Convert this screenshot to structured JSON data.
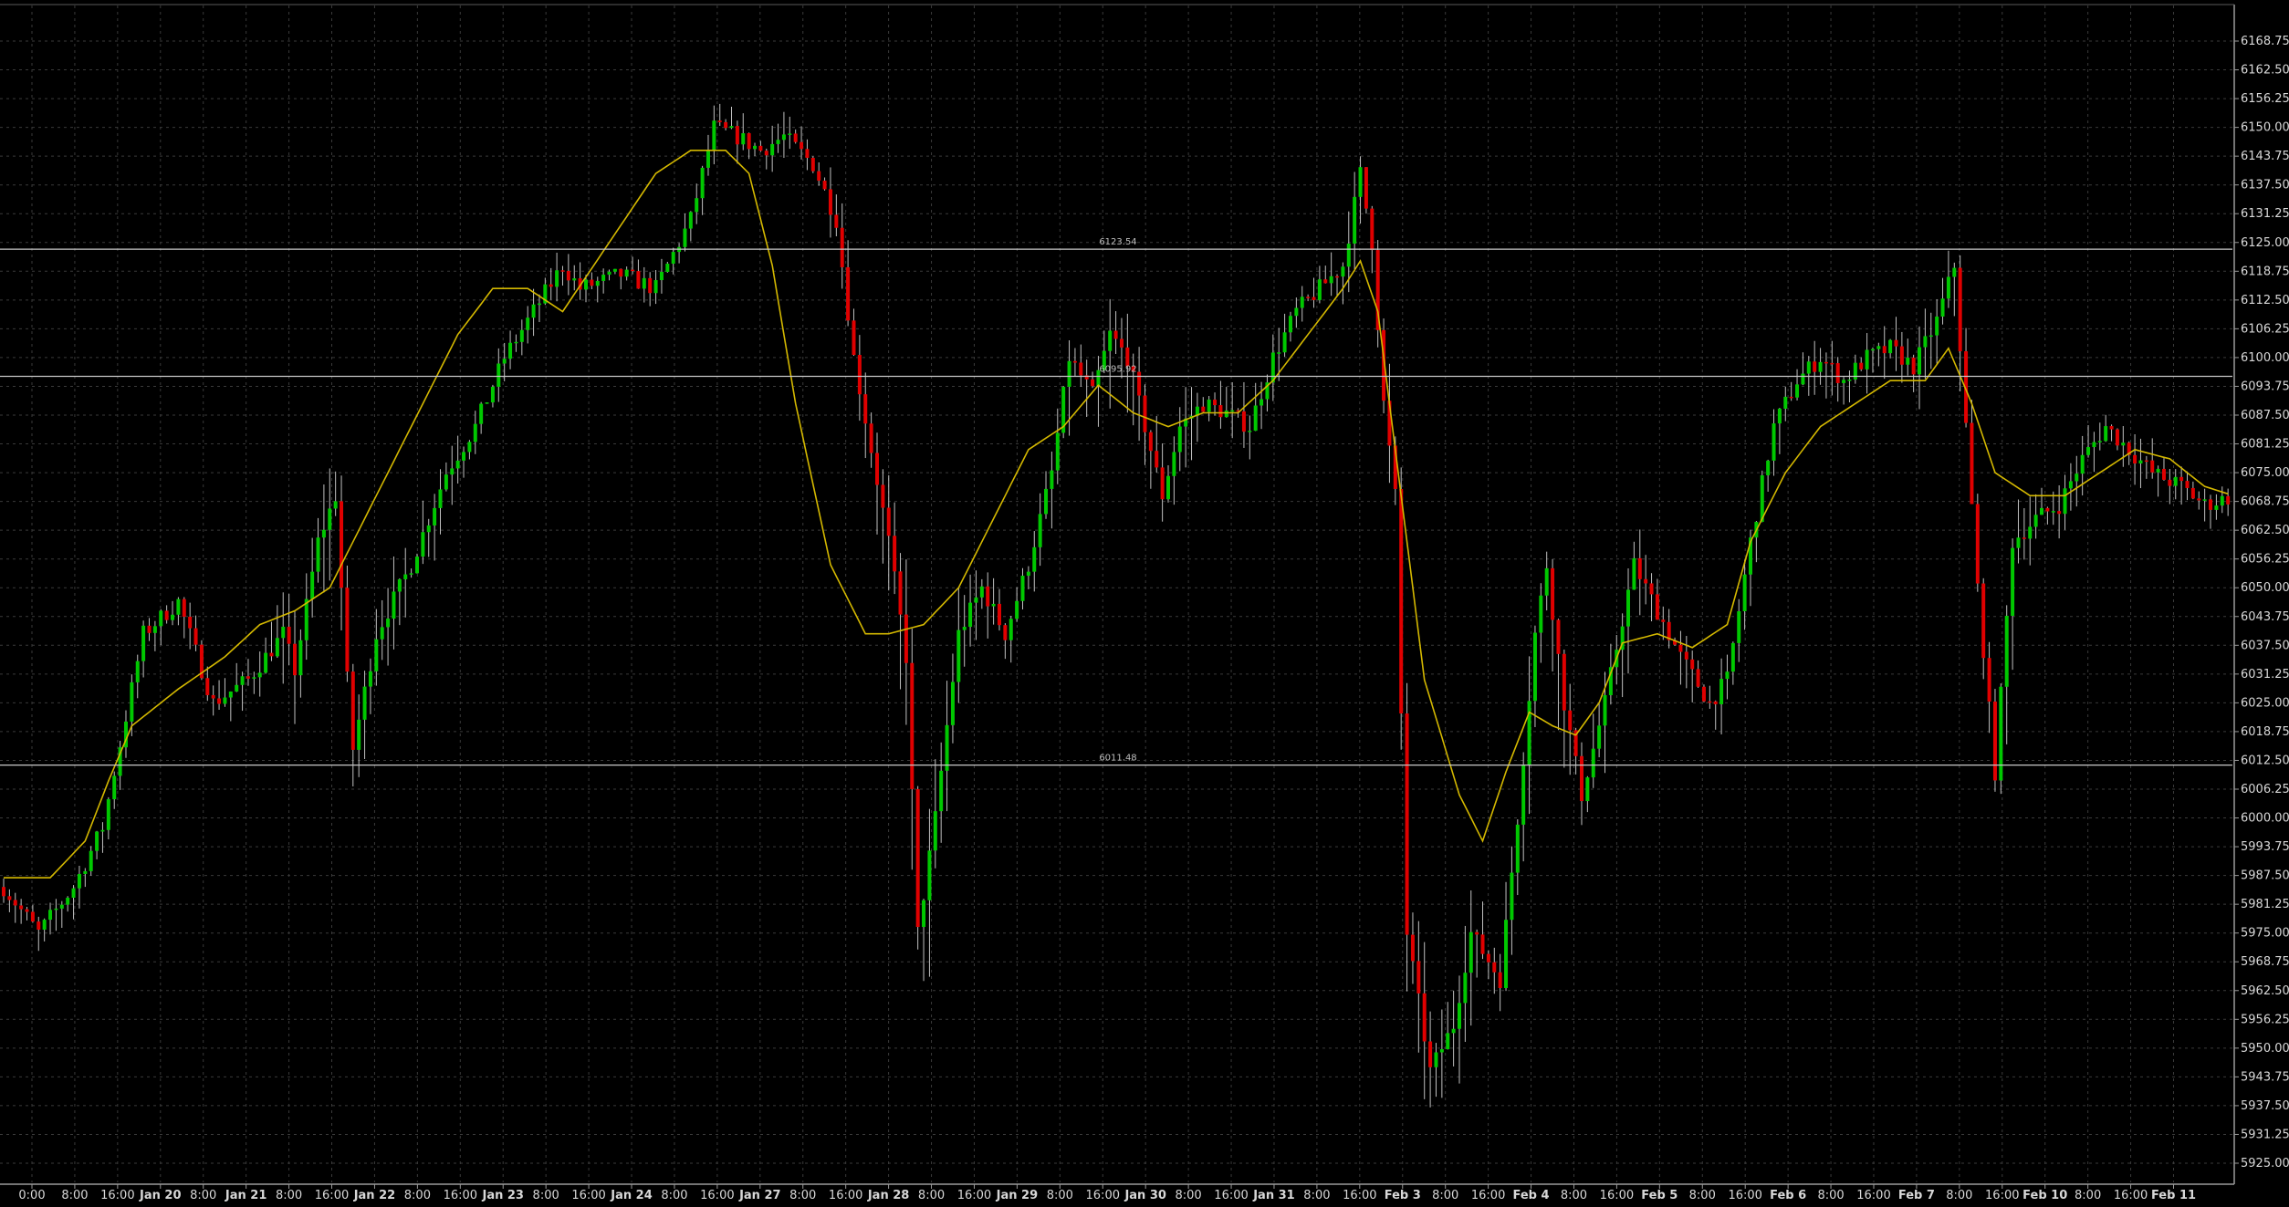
{
  "chart_data": {
    "type": "candlestick",
    "colors": {
      "background": "#000000",
      "grid": "#3a3a3a",
      "up_candle": "#00c800",
      "down_candle": "#e00000",
      "wick": "#c0c0c0",
      "moving_average": "#d4b800",
      "horizontal_line": "#c8c8c8",
      "axis_text": "#d8d8d8"
    },
    "y_axis": {
      "position": "right",
      "range": [
        5921.0,
        6172.0
      ],
      "tick_labels": [
        "6168.75",
        "6162.50",
        "6156.25",
        "6150.00",
        "6143.75",
        "6137.50",
        "6131.25",
        "6125.00",
        "6118.75",
        "6112.50",
        "6106.25",
        "6100.00",
        "6093.75",
        "6087.50",
        "6081.25",
        "6075.00",
        "6068.75",
        "6062.50",
        "6056.25",
        "6050.00",
        "6043.75",
        "6037.50",
        "6031.25",
        "6025.00",
        "6018.75",
        "6012.50",
        "6006.25",
        "6000.00",
        "5993.75",
        "5987.50",
        "5981.25",
        "5975.00",
        "5968.75",
        "5962.50",
        "5956.25",
        "5950.00",
        "5943.75",
        "5937.50",
        "5931.25",
        "5925.00"
      ]
    },
    "x_axis": {
      "tick_labels": [
        {
          "label": "0:00",
          "bold": false
        },
        {
          "label": "8:00",
          "bold": false
        },
        {
          "label": "16:00",
          "bold": false
        },
        {
          "label": "Jan 20",
          "bold": true
        },
        {
          "label": "8:00",
          "bold": false
        },
        {
          "label": "Jan 21",
          "bold": true
        },
        {
          "label": "8:00",
          "bold": false
        },
        {
          "label": "16:00",
          "bold": false
        },
        {
          "label": "Jan 22",
          "bold": true
        },
        {
          "label": "8:00",
          "bold": false
        },
        {
          "label": "16:00",
          "bold": false
        },
        {
          "label": "Jan 23",
          "bold": true
        },
        {
          "label": "8:00",
          "bold": false
        },
        {
          "label": "16:00",
          "bold": false
        },
        {
          "label": "Jan 24",
          "bold": true
        },
        {
          "label": "8:00",
          "bold": false
        },
        {
          "label": "16:00",
          "bold": false
        },
        {
          "label": "Jan 27",
          "bold": true
        },
        {
          "label": "8:00",
          "bold": false
        },
        {
          "label": "16:00",
          "bold": false
        },
        {
          "label": "Jan 28",
          "bold": true
        },
        {
          "label": "8:00",
          "bold": false
        },
        {
          "label": "16:00",
          "bold": false
        },
        {
          "label": "Jan 29",
          "bold": true
        },
        {
          "label": "8:00",
          "bold": false
        },
        {
          "label": "16:00",
          "bold": false
        },
        {
          "label": "Jan 30",
          "bold": true
        },
        {
          "label": "8:00",
          "bold": false
        },
        {
          "label": "16:00",
          "bold": false
        },
        {
          "label": "Jan 31",
          "bold": true
        },
        {
          "label": "8:00",
          "bold": false
        },
        {
          "label": "16:00",
          "bold": false
        },
        {
          "label": "Feb 3",
          "bold": true
        },
        {
          "label": "8:00",
          "bold": false
        },
        {
          "label": "16:00",
          "bold": false
        },
        {
          "label": "Feb 4",
          "bold": true
        },
        {
          "label": "8:00",
          "bold": false
        },
        {
          "label": "16:00",
          "bold": false
        },
        {
          "label": "Feb 5",
          "bold": true
        },
        {
          "label": "8:00",
          "bold": false
        },
        {
          "label": "16:00",
          "bold": false
        },
        {
          "label": "Feb 6",
          "bold": true
        },
        {
          "label": "8:00",
          "bold": false
        },
        {
          "label": "16:00",
          "bold": false
        },
        {
          "label": "Feb 7",
          "bold": true
        },
        {
          "label": "8:00",
          "bold": false
        },
        {
          "label": "16:00",
          "bold": false
        },
        {
          "label": "Feb 10",
          "bold": true
        },
        {
          "label": "8:00",
          "bold": false
        },
        {
          "label": "16:00",
          "bold": false
        },
        {
          "label": "Feb 11",
          "bold": true
        }
      ]
    },
    "horizontal_lines": [
      {
        "value": 6123.54,
        "label": "6123.54"
      },
      {
        "value": 6095.92,
        "label": "6095.92"
      },
      {
        "value": 6011.48,
        "label": "6011.48"
      }
    ],
    "price_path": [
      [
        0,
        5985
      ],
      [
        6,
        5975
      ],
      [
        12,
        5985
      ],
      [
        17,
        5998
      ],
      [
        24,
        6040
      ],
      [
        30,
        6047
      ],
      [
        36,
        6025
      ],
      [
        42,
        6030
      ],
      [
        48,
        6040
      ],
      [
        50,
        6032
      ],
      [
        54,
        6060
      ],
      [
        57,
        6070
      ],
      [
        59,
        6030
      ],
      [
        60,
        6015
      ],
      [
        64,
        6040
      ],
      [
        70,
        6055
      ],
      [
        76,
        6075
      ],
      [
        81,
        6085
      ],
      [
        86,
        6100
      ],
      [
        90,
        6108
      ],
      [
        96,
        6120
      ],
      [
        99,
        6115
      ],
      [
        106,
        6118
      ],
      [
        112,
        6115
      ],
      [
        118,
        6130
      ],
      [
        122,
        6150
      ],
      [
        126,
        6148
      ],
      [
        130,
        6145
      ],
      [
        134,
        6148
      ],
      [
        139,
        6142
      ],
      [
        143,
        6130
      ],
      [
        146,
        6100
      ],
      [
        149,
        6080
      ],
      [
        152,
        6060
      ],
      [
        155,
        6035
      ],
      [
        157,
        5975
      ],
      [
        160,
        6000
      ],
      [
        164,
        6040
      ],
      [
        168,
        6050
      ],
      [
        172,
        6040
      ],
      [
        176,
        6055
      ],
      [
        180,
        6075
      ],
      [
        183,
        6100
      ],
      [
        187,
        6092
      ],
      [
        190,
        6105
      ],
      [
        193,
        6100
      ],
      [
        196,
        6085
      ],
      [
        199,
        6070
      ],
      [
        202,
        6085
      ],
      [
        206,
        6090
      ],
      [
        210,
        6088
      ],
      [
        214,
        6085
      ],
      [
        218,
        6100
      ],
      [
        222,
        6110
      ],
      [
        226,
        6115
      ],
      [
        230,
        6120
      ],
      [
        233,
        6140
      ],
      [
        235,
        6125
      ],
      [
        237,
        6090
      ],
      [
        239,
        6070
      ],
      [
        241,
        5975
      ],
      [
        245,
        5945
      ],
      [
        249,
        5955
      ],
      [
        252,
        5975
      ],
      [
        257,
        5965
      ],
      [
        260,
        6000
      ],
      [
        263,
        6040
      ],
      [
        265,
        6055
      ],
      [
        268,
        6025
      ],
      [
        271,
        6005
      ],
      [
        275,
        6025
      ],
      [
        280,
        6055
      ],
      [
        284,
        6045
      ],
      [
        288,
        6035
      ],
      [
        293,
        6025
      ],
      [
        296,
        6030
      ],
      [
        300,
        6060
      ],
      [
        304,
        6085
      ],
      [
        308,
        6095
      ],
      [
        312,
        6100
      ],
      [
        316,
        6095
      ],
      [
        320,
        6100
      ],
      [
        324,
        6102
      ],
      [
        328,
        6098
      ],
      [
        332,
        6108
      ],
      [
        335,
        6120
      ],
      [
        337,
        6085
      ],
      [
        339,
        6050
      ],
      [
        342,
        6010
      ],
      [
        345,
        6060
      ],
      [
        349,
        6065
      ],
      [
        353,
        6068
      ],
      [
        357,
        6078
      ],
      [
        361,
        6085
      ],
      [
        365,
        6080
      ],
      [
        369,
        6075
      ],
      [
        374,
        6072
      ],
      [
        378,
        6068
      ],
      [
        383,
        6070
      ]
    ],
    "moving_average": [
      [
        0,
        5987
      ],
      [
        8,
        5987
      ],
      [
        14,
        5995
      ],
      [
        18,
        6008
      ],
      [
        22,
        6020
      ],
      [
        30,
        6028
      ],
      [
        38,
        6035
      ],
      [
        44,
        6042
      ],
      [
        50,
        6045
      ],
      [
        56,
        6050
      ],
      [
        62,
        6065
      ],
      [
        70,
        6085
      ],
      [
        78,
        6105
      ],
      [
        84,
        6115
      ],
      [
        90,
        6115
      ],
      [
        96,
        6110
      ],
      [
        104,
        6125
      ],
      [
        112,
        6140
      ],
      [
        118,
        6145
      ],
      [
        124,
        6145
      ],
      [
        128,
        6140
      ],
      [
        132,
        6120
      ],
      [
        136,
        6090
      ],
      [
        142,
        6055
      ],
      [
        148,
        6040
      ],
      [
        152,
        6040
      ],
      [
        158,
        6042
      ],
      [
        164,
        6050
      ],
      [
        170,
        6065
      ],
      [
        176,
        6080
      ],
      [
        182,
        6085
      ],
      [
        188,
        6094
      ],
      [
        194,
        6088
      ],
      [
        200,
        6085
      ],
      [
        206,
        6088
      ],
      [
        212,
        6088
      ],
      [
        218,
        6095
      ],
      [
        224,
        6105
      ],
      [
        230,
        6115
      ],
      [
        233,
        6121
      ],
      [
        236,
        6110
      ],
      [
        240,
        6070
      ],
      [
        244,
        6030
      ],
      [
        250,
        6005
      ],
      [
        254,
        5995
      ],
      [
        258,
        6010
      ],
      [
        262,
        6023
      ],
      [
        266,
        6020
      ],
      [
        270,
        6018
      ],
      [
        274,
        6025
      ],
      [
        278,
        6038
      ],
      [
        284,
        6040
      ],
      [
        290,
        6037
      ],
      [
        296,
        6042
      ],
      [
        300,
        6060
      ],
      [
        306,
        6075
      ],
      [
        312,
        6085
      ],
      [
        318,
        6090
      ],
      [
        324,
        6095
      ],
      [
        330,
        6095
      ],
      [
        334,
        6102
      ],
      [
        338,
        6090
      ],
      [
        342,
        6075
      ],
      [
        348,
        6070
      ],
      [
        354,
        6070
      ],
      [
        360,
        6075
      ],
      [
        366,
        6080
      ],
      [
        372,
        6078
      ],
      [
        378,
        6072
      ],
      [
        383,
        6070
      ]
    ],
    "volatility": {
      "high": [
        [
          0,
          2
        ],
        [
          30,
          3
        ],
        [
          44,
          6
        ],
        [
          50,
          10
        ],
        [
          60,
          10
        ],
        [
          86,
          4
        ],
        [
          120,
          4
        ],
        [
          146,
          6
        ],
        [
          150,
          5
        ],
        [
          156,
          16
        ],
        [
          175,
          6
        ],
        [
          186,
          5
        ],
        [
          196,
          10
        ],
        [
          200,
          8
        ],
        [
          225,
          5
        ],
        [
          234,
          9
        ],
        [
          241,
          12
        ],
        [
          256,
          10
        ],
        [
          262,
          10
        ],
        [
          266,
          9
        ],
        [
          290,
          5
        ],
        [
          320,
          5
        ],
        [
          335,
          8
        ],
        [
          340,
          5
        ],
        [
          345,
          9
        ],
        [
          350,
          6
        ],
        [
          383,
          4
        ]
      ],
      "low": [
        [
          0,
          5
        ],
        [
          30,
          5
        ],
        [
          44,
          6
        ],
        [
          50,
          12
        ],
        [
          60,
          12
        ],
        [
          86,
          4
        ],
        [
          120,
          4
        ],
        [
          146,
          6
        ],
        [
          156,
          22
        ],
        [
          175,
          6
        ],
        [
          186,
          14
        ],
        [
          196,
          16
        ],
        [
          200,
          10
        ],
        [
          225,
          5
        ],
        [
          234,
          9
        ],
        [
          241,
          14
        ],
        [
          256,
          12
        ],
        [
          262,
          12
        ],
        [
          266,
          18
        ],
        [
          290,
          8
        ],
        [
          320,
          8
        ],
        [
          335,
          10
        ],
        [
          340,
          10
        ],
        [
          345,
          14
        ],
        [
          350,
          6
        ],
        [
          383,
          5
        ]
      ]
    }
  }
}
